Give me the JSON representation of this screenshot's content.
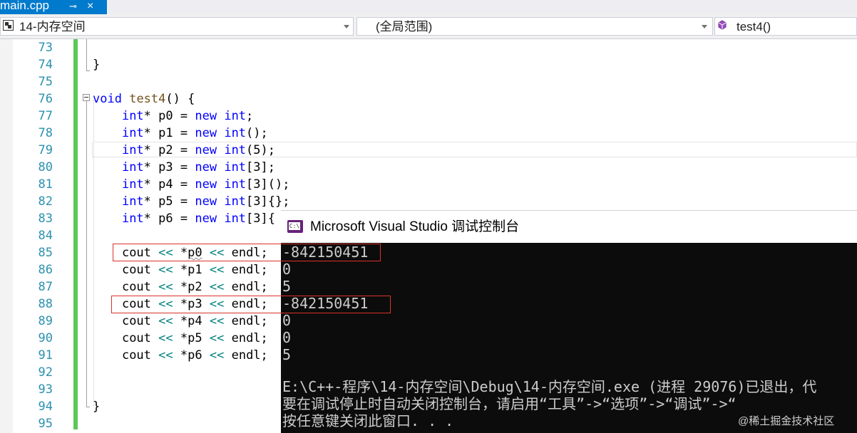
{
  "tab": {
    "title": "main.cpp",
    "pin": "⊸",
    "close": "×"
  },
  "navbar": {
    "project": "14-内存空间",
    "scope": "(全局范围)",
    "member": "test4()"
  },
  "line_numbers": [
    "73",
    "74",
    "75",
    "76",
    "77",
    "78",
    "79",
    "80",
    "81",
    "82",
    "83",
    "84",
    "85",
    "86",
    "87",
    "88",
    "89",
    "90",
    "91",
    "92",
    "93",
    "94",
    "95"
  ],
  "code": {
    "l74": "}",
    "l76_kw": "void",
    "l76_fn": "test4",
    "l76_rest": "() {",
    "decls": [
      {
        "var": "p0",
        "tail": ";"
      },
      {
        "var": "p1",
        "tail": "();"
      },
      {
        "var": "p2",
        "tail": "(5);"
      },
      {
        "var": "p3",
        "tail": "[3];"
      },
      {
        "var": "p4",
        "tail": "[3]();"
      },
      {
        "var": "p5",
        "tail": "[3]{};"
      },
      {
        "var": "p6",
        "tail": "[3]{"
      }
    ],
    "int_kw": "int",
    "new_kw": "new",
    "couts": [
      {
        "ptr": "p0"
      },
      {
        "ptr": "p1"
      },
      {
        "ptr": "p2"
      },
      {
        "ptr": "p3"
      },
      {
        "ptr": "p4"
      },
      {
        "ptr": "p5"
      },
      {
        "ptr": "p6"
      }
    ],
    "cout": "cout",
    "shl": "<<",
    "endl": "endl;",
    "l94": "}"
  },
  "console": {
    "title": "Microsoft Visual Studio 调试控制台",
    "icon_label": "C:\\",
    "output": [
      "-842150451",
      "0",
      "5",
      "-842150451",
      "0",
      "0",
      "5"
    ],
    "footer": [
      "E:\\C++-程序\\14-内存空间\\Debug\\14-内存空间.exe (进程 29076)已退出，代",
      "要在调试停止时自动关闭控制台，请启用“工具”->“选项”->“调试”->“",
      "按任意键关闭此窗口. . ."
    ]
  },
  "watermark": "@稀土掘金技术社区"
}
